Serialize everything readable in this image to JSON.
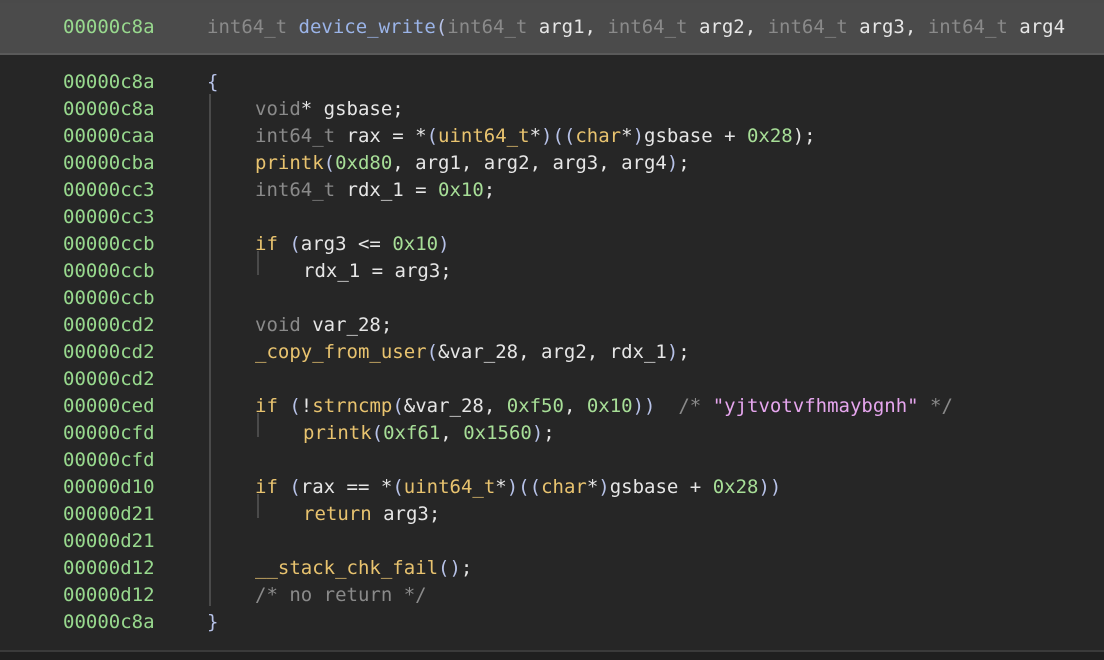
{
  "header": {
    "address": "00000c8a",
    "signature_parts": [
      {
        "t": "int64_t ",
        "c": "type"
      },
      {
        "t": "device_write",
        "c": "fn"
      },
      {
        "t": "(",
        "c": "punc"
      },
      {
        "t": "int64_t ",
        "c": "type"
      },
      {
        "t": "arg1",
        "c": "plain"
      },
      {
        "t": ", ",
        "c": "plain"
      },
      {
        "t": "int64_t ",
        "c": "type"
      },
      {
        "t": "arg2",
        "c": "plain"
      },
      {
        "t": ", ",
        "c": "plain"
      },
      {
        "t": "int64_t ",
        "c": "type"
      },
      {
        "t": "arg3",
        "c": "plain"
      },
      {
        "t": ", ",
        "c": "plain"
      },
      {
        "t": "int64_t ",
        "c": "type"
      },
      {
        "t": "arg4",
        "c": "plain"
      }
    ]
  },
  "lines": [
    {
      "addr": "00000c8a",
      "indent": 0,
      "parts": [
        {
          "t": "{",
          "c": "punc"
        }
      ]
    },
    {
      "addr": "00000c8a",
      "indent": 1,
      "parts": [
        {
          "t": "void",
          "c": "type"
        },
        {
          "t": "* gsbase;",
          "c": "plain"
        }
      ]
    },
    {
      "addr": "00000caa",
      "indent": 1,
      "parts": [
        {
          "t": "int64_t",
          "c": "type"
        },
        {
          "t": " rax = *",
          "c": "plain"
        },
        {
          "t": "(",
          "c": "punc"
        },
        {
          "t": "uint64_t",
          "c": "kw"
        },
        {
          "t": "*",
          "c": "plain"
        },
        {
          "t": ")((",
          "c": "punc"
        },
        {
          "t": "char",
          "c": "kw"
        },
        {
          "t": "*",
          "c": "plain"
        },
        {
          "t": ")",
          "c": "punc"
        },
        {
          "t": "gsbase + ",
          "c": "plain"
        },
        {
          "t": "0x28",
          "c": "num"
        },
        {
          "t": ");",
          "c": "plain"
        }
      ]
    },
    {
      "addr": "00000cba",
      "indent": 1,
      "parts": [
        {
          "t": "printk",
          "c": "fn-y"
        },
        {
          "t": "(",
          "c": "punc"
        },
        {
          "t": "0xd80",
          "c": "num"
        },
        {
          "t": ", arg1, arg2, arg3, arg4",
          "c": "plain"
        },
        {
          "t": ")",
          "c": "punc"
        },
        {
          "t": ";",
          "c": "plain"
        }
      ]
    },
    {
      "addr": "00000cc3",
      "indent": 1,
      "parts": [
        {
          "t": "int64_t",
          "c": "type"
        },
        {
          "t": " rdx_1 = ",
          "c": "plain"
        },
        {
          "t": "0x10",
          "c": "num"
        },
        {
          "t": ";",
          "c": "plain"
        }
      ]
    },
    {
      "addr": "00000cc3",
      "indent": 1,
      "parts": []
    },
    {
      "addr": "00000ccb",
      "indent": 1,
      "parts": [
        {
          "t": "if",
          "c": "kw"
        },
        {
          "t": " ",
          "c": "plain"
        },
        {
          "t": "(",
          "c": "punc"
        },
        {
          "t": "arg3 <= ",
          "c": "plain"
        },
        {
          "t": "0x10",
          "c": "num"
        },
        {
          "t": ")",
          "c": "punc"
        }
      ]
    },
    {
      "addr": "00000ccb",
      "indent": 2,
      "parts": [
        {
          "t": "rdx_1 = arg3;",
          "c": "plain"
        }
      ]
    },
    {
      "addr": "00000ccb",
      "indent": 1,
      "parts": []
    },
    {
      "addr": "00000cd2",
      "indent": 1,
      "parts": [
        {
          "t": "void",
          "c": "type"
        },
        {
          "t": " var_28;",
          "c": "plain"
        }
      ]
    },
    {
      "addr": "00000cd2",
      "indent": 1,
      "parts": [
        {
          "t": "_copy_from_user",
          "c": "fn-y"
        },
        {
          "t": "(",
          "c": "punc"
        },
        {
          "t": "&var_28, arg2, rdx_1",
          "c": "plain"
        },
        {
          "t": ")",
          "c": "punc"
        },
        {
          "t": ";",
          "c": "plain"
        }
      ]
    },
    {
      "addr": "00000cd2",
      "indent": 1,
      "parts": []
    },
    {
      "addr": "00000ced",
      "indent": 1,
      "parts": [
        {
          "t": "if",
          "c": "kw"
        },
        {
          "t": " ",
          "c": "plain"
        },
        {
          "t": "(",
          "c": "punc"
        },
        {
          "t": "!",
          "c": "plain"
        },
        {
          "t": "strncmp",
          "c": "fn-y"
        },
        {
          "t": "(",
          "c": "punc"
        },
        {
          "t": "&var_28, ",
          "c": "plain"
        },
        {
          "t": "0xf50",
          "c": "num"
        },
        {
          "t": ", ",
          "c": "plain"
        },
        {
          "t": "0x10",
          "c": "num"
        },
        {
          "t": "))",
          "c": "punc"
        },
        {
          "t": "  /* ",
          "c": "cmt"
        },
        {
          "t": "\"yjtvotvfhmaybgnh\"",
          "c": "str"
        },
        {
          "t": " */",
          "c": "cmt"
        }
      ]
    },
    {
      "addr": "00000cfd",
      "indent": 2,
      "parts": [
        {
          "t": "printk",
          "c": "fn-y"
        },
        {
          "t": "(",
          "c": "punc"
        },
        {
          "t": "0xf61",
          "c": "num"
        },
        {
          "t": ", ",
          "c": "plain"
        },
        {
          "t": "0x1560",
          "c": "num"
        },
        {
          "t": ")",
          "c": "punc"
        },
        {
          "t": ";",
          "c": "plain"
        }
      ]
    },
    {
      "addr": "00000cfd",
      "indent": 1,
      "parts": []
    },
    {
      "addr": "00000d10",
      "indent": 1,
      "parts": [
        {
          "t": "if",
          "c": "kw"
        },
        {
          "t": " ",
          "c": "plain"
        },
        {
          "t": "(",
          "c": "punc"
        },
        {
          "t": "rax == *",
          "c": "plain"
        },
        {
          "t": "(",
          "c": "punc"
        },
        {
          "t": "uint64_t",
          "c": "kw"
        },
        {
          "t": "*",
          "c": "plain"
        },
        {
          "t": ")((",
          "c": "punc"
        },
        {
          "t": "char",
          "c": "kw"
        },
        {
          "t": "*",
          "c": "plain"
        },
        {
          "t": ")",
          "c": "punc"
        },
        {
          "t": "gsbase + ",
          "c": "plain"
        },
        {
          "t": "0x28",
          "c": "num"
        },
        {
          "t": "))",
          "c": "punc"
        }
      ]
    },
    {
      "addr": "00000d21",
      "indent": 2,
      "parts": [
        {
          "t": "return",
          "c": "kw"
        },
        {
          "t": " arg3;",
          "c": "plain"
        }
      ]
    },
    {
      "addr": "00000d21",
      "indent": 1,
      "parts": []
    },
    {
      "addr": "00000d12",
      "indent": 1,
      "parts": [
        {
          "t": "__stack_chk_fail",
          "c": "fn-y"
        },
        {
          "t": "()",
          "c": "punc"
        },
        {
          "t": ";",
          "c": "plain"
        }
      ]
    },
    {
      "addr": "00000d12",
      "indent": 1,
      "parts": [
        {
          "t": "/* no return */",
          "c": "cmt"
        }
      ]
    },
    {
      "addr": "00000c8a",
      "indent": 0,
      "parts": [
        {
          "t": "}",
          "c": "punc"
        }
      ]
    }
  ]
}
